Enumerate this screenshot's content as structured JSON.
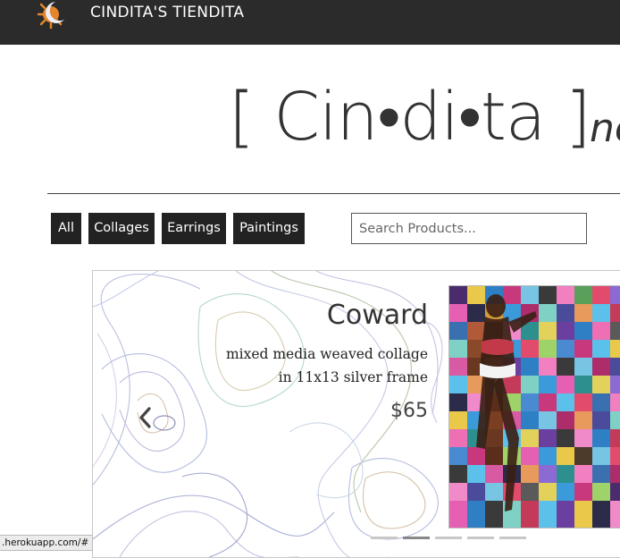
{
  "navbar": {
    "brand_name": "CINDITA'S TIENDITA",
    "logo_icon": "moon-sun-logo-icon",
    "bg_color": "#2b2b2b"
  },
  "hero": {
    "title": "[ Cin•di•ta ]",
    "subtitle_partial": "no"
  },
  "filters": {
    "buttons": [
      {
        "label": "All"
      },
      {
        "label": "Collages"
      },
      {
        "label": "Earrings"
      },
      {
        "label": "Paintings"
      }
    ],
    "search_placeholder": "Search Products..."
  },
  "carousel": {
    "product": {
      "title": "Coward",
      "description": "mixed media weaved collage in 11x13 silver frame",
      "price": "$65",
      "image_icon": "woven-collage-image"
    },
    "prev_icon": "chevron-left-icon",
    "indicator_count": 5,
    "active_indicator": 2
  },
  "status_bar": {
    "url": ".herokuapp.com/#"
  }
}
